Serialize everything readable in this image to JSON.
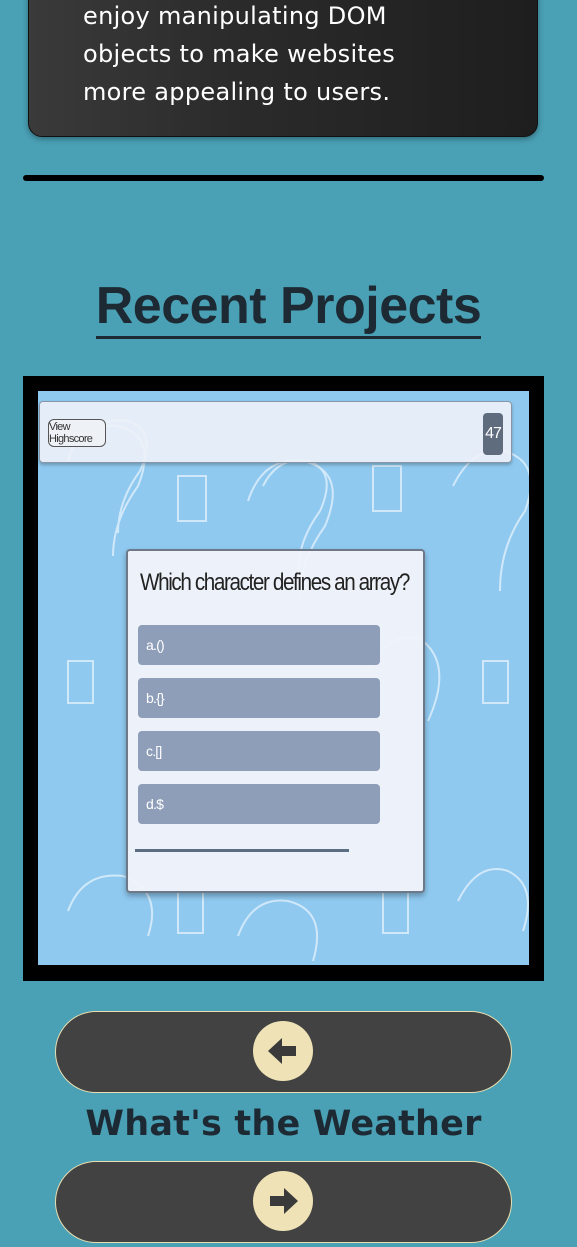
{
  "about": {
    "lines": [
      "enjoy manipulating DOM",
      "objects to make websites",
      "more appealing to users."
    ]
  },
  "projects_section": {
    "title": "Recent Projects",
    "current_project": {
      "name": "What's the Weather",
      "screenshot": {
        "highscore_button": "View Highscore",
        "timer": "47",
        "question": "Which character defines an array?",
        "answers": [
          "a.()",
          "b.{}",
          "c.[]",
          "d.$"
        ]
      }
    },
    "prev_icon": "arrow-left-icon",
    "next_icon": "arrow-right-icon"
  },
  "colors": {
    "background": "#4aa0b5",
    "card": "#2b2b2b",
    "pill": "#424242",
    "pill_border": "#e8dfb0",
    "circle": "#eee2b6",
    "title": "#1d2a33"
  }
}
